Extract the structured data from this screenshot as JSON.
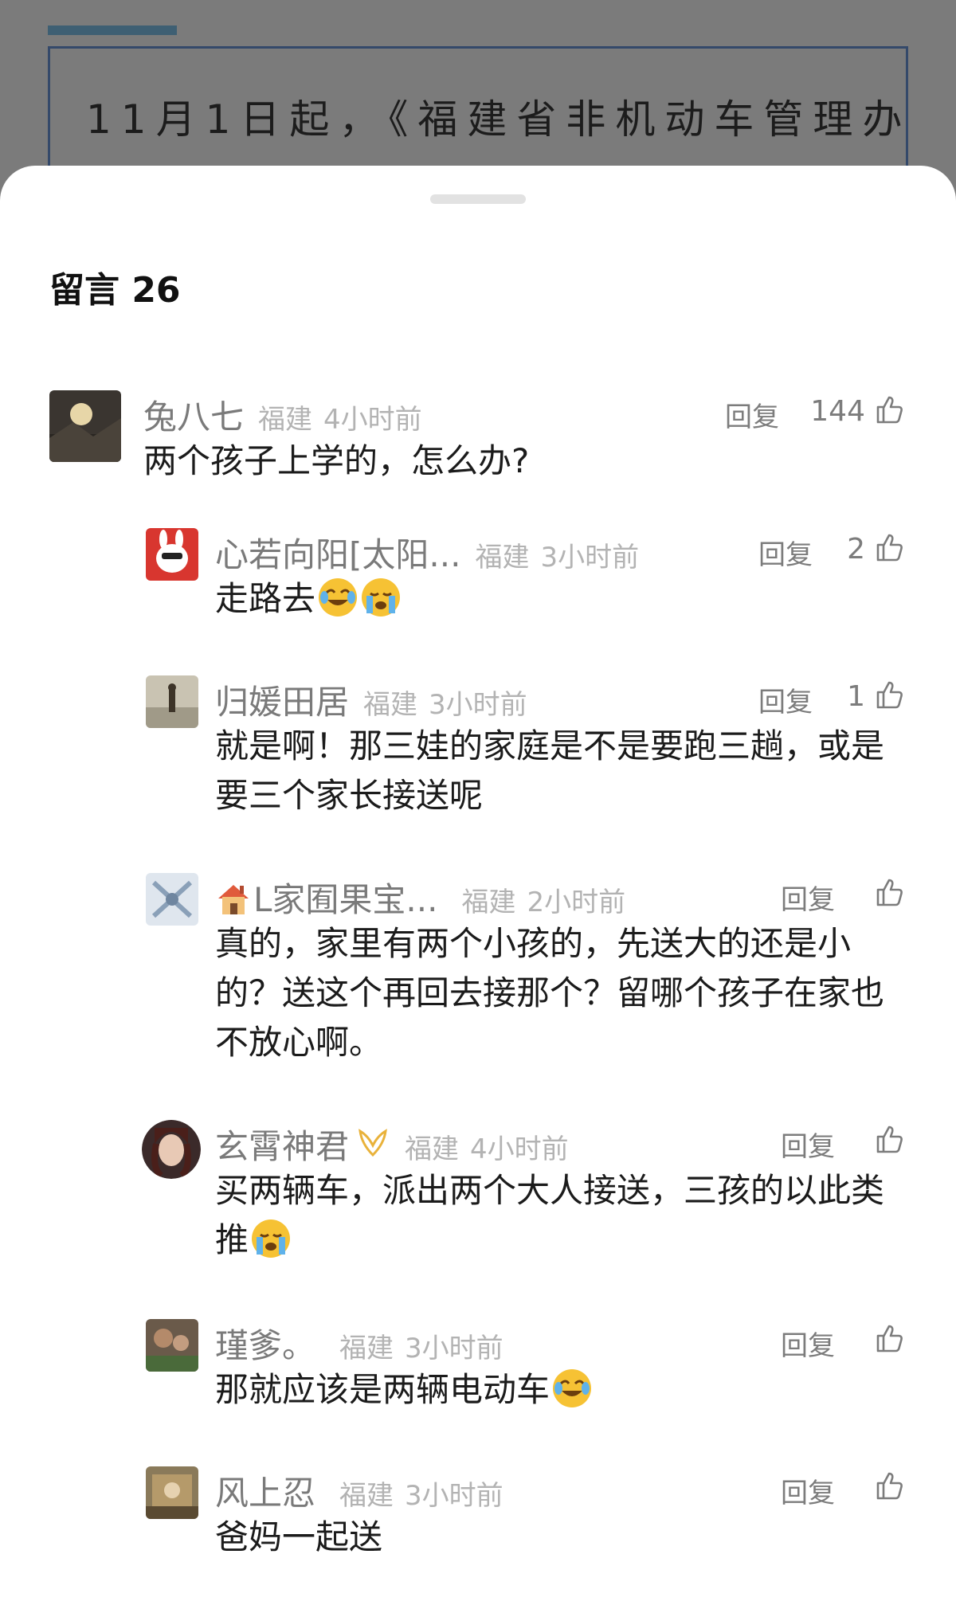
{
  "background": {
    "headline": "11月1日起，《福建省非机动车管理办"
  },
  "sheet": {
    "title": "留言 26"
  },
  "comments": [
    {
      "name": "兔八七",
      "location": "福建",
      "time": "4小时前",
      "reply_label": "回复",
      "likes": "144",
      "text": "两个孩子上学的，怎么办?"
    },
    {
      "name": "心若向阳[太阳...",
      "location": "福建",
      "time": "3小时前",
      "reply_label": "回复",
      "likes": "2",
      "text": "走路去"
    },
    {
      "name": "归媛田居",
      "location": "福建",
      "time": "3小时前",
      "reply_label": "回复",
      "likes": "1",
      "text": "就是啊！那三娃的家庭是不是要跑三趟，或是要三个家长接送呢"
    },
    {
      "name": "L家囿果宝...",
      "location": "福建",
      "time": "2小时前",
      "reply_label": "回复",
      "likes": "",
      "text": "真的，家里有两个小孩的，先送大的还是小的？送这个再回去接那个？留哪个孩子在家也不放心啊。"
    },
    {
      "name": "玄霄神君",
      "location": "福建",
      "time": "4小时前",
      "reply_label": "回复",
      "likes": "",
      "text": "买两辆车，派出两个大人接送，三孩的以此类推"
    },
    {
      "name": "瑾爹。",
      "location": "福建",
      "time": "3小时前",
      "reply_label": "回复",
      "likes": "",
      "text": "那就应该是两辆电动车"
    },
    {
      "name": "风上忍",
      "location": "福建",
      "time": "3小时前",
      "reply_label": "回复",
      "likes": "",
      "text": "爸妈一起送"
    }
  ],
  "icons": {
    "like": "thumbs-up-icon",
    "laugh": "face-with-tears-of-joy-icon",
    "cry": "loudly-crying-face-icon",
    "house": "house-icon",
    "verified": "verified-badge-icon"
  }
}
